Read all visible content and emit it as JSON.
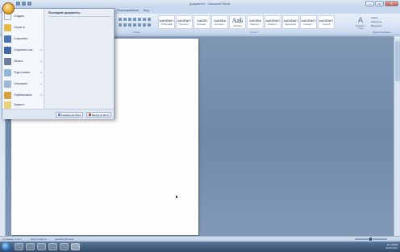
{
  "window": {
    "title": "Документ1 - Microsoft Word"
  },
  "controls": {
    "minimize": "–",
    "maximize": "▭",
    "close": "✕"
  },
  "ribbon": {
    "tabs": [
      "Рецензирование",
      "Вид"
    ],
    "group_labels": {
      "paragraph": "Абзац",
      "styles": "Стили",
      "editing": "Редактирование"
    },
    "styles": [
      {
        "sample": "АаБбВвГг",
        "name": "¶ Обычный"
      },
      {
        "sample": "АаБбВвГг",
        "name": "¶ Без инте..."
      },
      {
        "sample": "АаБбВ",
        "name": "Заголово..."
      },
      {
        "sample": "АаБбВв",
        "name": "Заголово..."
      },
      {
        "sample": "АаБ",
        "name": "Название"
      },
      {
        "sample": "АаБбВв",
        "name": "Подзагол..."
      },
      {
        "sample": "АаБбВвГг",
        "name": "Слабое в..."
      },
      {
        "sample": "АаБбВвГг",
        "name": "Выделение"
      },
      {
        "sample": "АаБбВвГг",
        "name": "Сильное..."
      },
      {
        "sample": "АаБбВвГг",
        "name": "Строгий"
      },
      {
        "sample": "АаБбВвГг",
        "name": "Цитата 2"
      }
    ],
    "change_styles": "Изменить стили",
    "editing": [
      "Найти",
      "Заменить",
      "Выделить"
    ]
  },
  "office_menu": {
    "items": [
      {
        "label": "Создать",
        "icon_color": "#f3f6fb",
        "has_submenu": false
      },
      {
        "label": "Открыть",
        "icon_color": "#e6b84a",
        "has_submenu": false
      },
      {
        "label": "Сохранить",
        "icon_color": "#4a74b0",
        "has_submenu": false
      },
      {
        "label": "Сохранить как",
        "icon_color": "#3f68a5",
        "has_submenu": true
      },
      {
        "label": "Печать",
        "icon_color": "#6b7f9a",
        "has_submenu": true
      },
      {
        "label": "Подготовить",
        "icon_color": "#8fb6d9",
        "has_submenu": true
      },
      {
        "label": "Отправить",
        "icon_color": "#9db7d6",
        "has_submenu": true
      },
      {
        "label": "Опубликовать",
        "icon_color": "#d4a23c",
        "has_submenu": true
      },
      {
        "label": "Закрыть",
        "icon_color": "#e8cf7a",
        "has_submenu": false
      }
    ],
    "recent_title": "Последние документы",
    "footer": {
      "options": "Параметры Word",
      "exit": "Выход из Word"
    }
  },
  "statusbar": {
    "page": "Страница: 1 из 1",
    "words": "Число слов: 0",
    "lang": "русский (Россия)"
  },
  "taskbar": {
    "lang": "RU",
    "time": "19:56",
    "date": "22.06.2011"
  },
  "colors": {
    "accent": "#1f3a63",
    "document_bg": "#6f88a7",
    "taskbar": "#324b6b"
  }
}
